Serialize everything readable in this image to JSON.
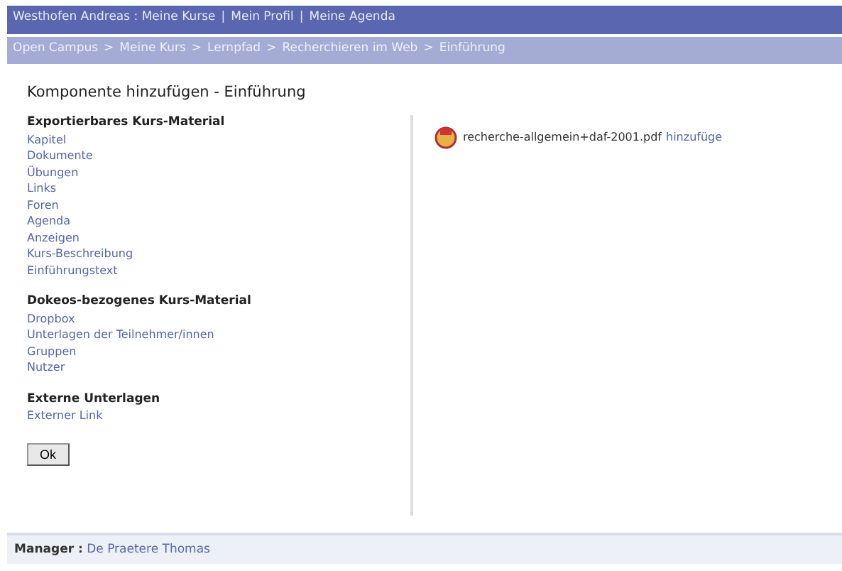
{
  "top_nav": [
    "Westhofen Andreas : Meine Kurse",
    "Mein Profil",
    "Meine Agenda"
  ],
  "breadcrumb": [
    "Open Campus",
    "Meine Kurs",
    "Lernpfad",
    "Recherchieren im Web",
    "Einführung"
  ],
  "top_nav_separator": "|",
  "breadcrumb_separator": ">",
  "title": "Komponente hinzufügen - Einführung",
  "sections": [
    {
      "heading": "Exportierbares Kurs-Material",
      "links": [
        "Kapitel",
        "Dokumente",
        "Übungen",
        "Links",
        "Foren",
        "Agenda",
        "Anzeigen",
        "Kurs-Beschreibung",
        "Einführungstext"
      ]
    },
    {
      "heading": "Dokeos-bezogenes Kurs-Material",
      "links": [
        "Dropbox",
        "Unterlagen der Teilnehmer/innen",
        "Gruppen",
        "Nutzer"
      ]
    },
    {
      "heading": "Externe Unterlagen",
      "links": [
        "Externer Link"
      ]
    }
  ],
  "ok_button": "Ok",
  "file": {
    "name": "recherche-allgemein+daf-2001.pdf",
    "action": "hinzufüge"
  },
  "footer": {
    "label": "Manager :",
    "name": "De Praetere Thomas"
  }
}
